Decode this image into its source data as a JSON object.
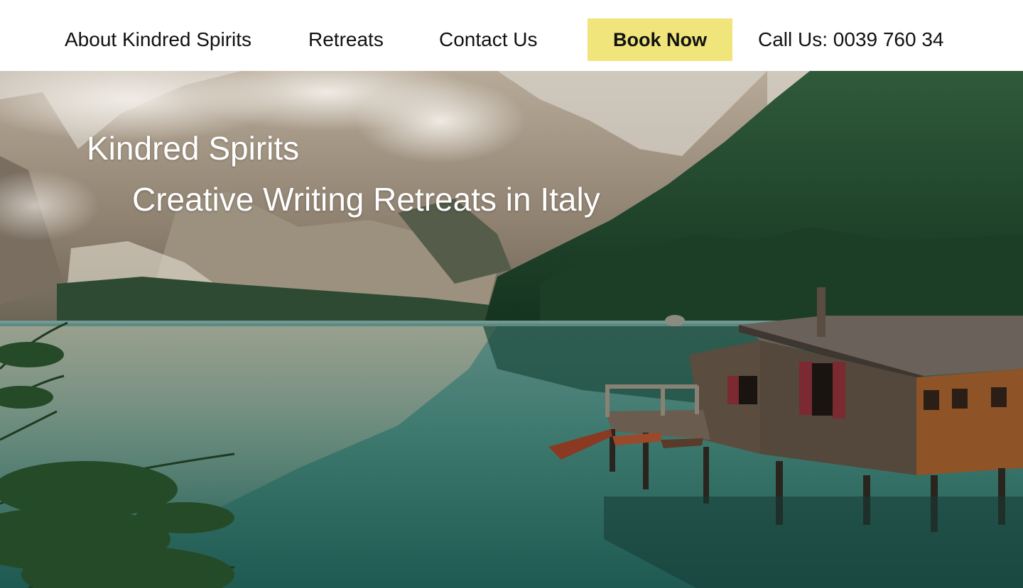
{
  "nav": {
    "about_label": "About Kindred Spirits",
    "retreats_label": "Retreats",
    "contact_label": "Contact Us",
    "book_label": "Book Now",
    "phone_text": "Call Us: 0039 760 34"
  },
  "hero": {
    "title": "Kindred Spirits",
    "subtitle": "Creative Writing Retreats in Italy",
    "image_subject": "mountain lake with wooden boathouse and rowing boats"
  },
  "colors": {
    "book_button_bg": "#f0e57b",
    "nav_text": "#111111",
    "hero_text": "#ffffff",
    "lake": "#2e6e66",
    "forest": "#1f4a2c"
  }
}
